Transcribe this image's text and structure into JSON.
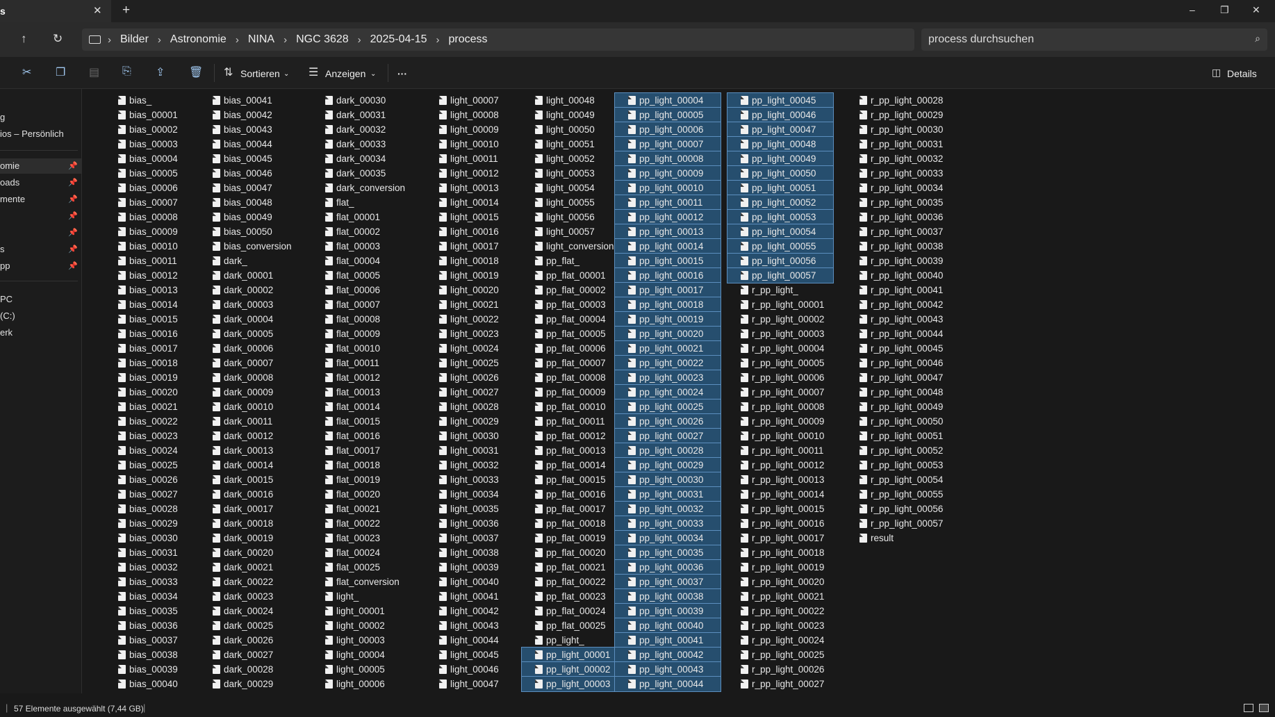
{
  "tab": {
    "title": "s",
    "close": "✕",
    "new": "+"
  },
  "window": {
    "minimize": "–",
    "maximize": "❐",
    "close": "✕"
  },
  "nav": {
    "up": "↑",
    "refresh": "↻"
  },
  "breadcrumb": [
    "Bilder",
    "Astronomie",
    "NINA",
    "NGC 3628",
    "2025-04-15",
    "process"
  ],
  "search": {
    "placeholder": "process durchsuchen"
  },
  "toolbar": {
    "sort": "Sortieren",
    "view": "Anzeigen",
    "more": "···",
    "details": "Details"
  },
  "sidebar": {
    "items": [
      {
        "label": "g"
      },
      {
        "label": "ios – Persönlich"
      },
      {
        "label": "omie"
      },
      {
        "label": "oads"
      },
      {
        "label": "mente"
      },
      {
        "label": ""
      },
      {
        "label": ""
      },
      {
        "label": "s"
      },
      {
        "label": "pp"
      },
      {
        "label": " PC"
      },
      {
        "label": "(C:)"
      },
      {
        "label": "erk"
      }
    ]
  },
  "columns": [
    [
      "bias_",
      "bias_00001",
      "bias_00002",
      "bias_00003",
      "bias_00004",
      "bias_00005",
      "bias_00006",
      "bias_00007",
      "bias_00008",
      "bias_00009",
      "bias_00010",
      "bias_00011",
      "bias_00012",
      "bias_00013",
      "bias_00014",
      "bias_00015",
      "bias_00016",
      "bias_00017",
      "bias_00018",
      "bias_00019",
      "bias_00020",
      "bias_00021",
      "bias_00022",
      "bias_00023",
      "bias_00024",
      "bias_00025",
      "bias_00026",
      "bias_00027",
      "bias_00028",
      "bias_00029",
      "bias_00030",
      "bias_00031",
      "bias_00032",
      "bias_00033",
      "bias_00034",
      "bias_00035",
      "bias_00036",
      "bias_00037",
      "bias_00038",
      "bias_00039",
      "bias_00040"
    ],
    [
      "bias_00041",
      "bias_00042",
      "bias_00043",
      "bias_00044",
      "bias_00045",
      "bias_00046",
      "bias_00047",
      "bias_00048",
      "bias_00049",
      "bias_00050",
      "bias_conversion",
      "dark_",
      "dark_00001",
      "dark_00002",
      "dark_00003",
      "dark_00004",
      "dark_00005",
      "dark_00006",
      "dark_00007",
      "dark_00008",
      "dark_00009",
      "dark_00010",
      "dark_00011",
      "dark_00012",
      "dark_00013",
      "dark_00014",
      "dark_00015",
      "dark_00016",
      "dark_00017",
      "dark_00018",
      "dark_00019",
      "dark_00020",
      "dark_00021",
      "dark_00022",
      "dark_00023",
      "dark_00024",
      "dark_00025",
      "dark_00026",
      "dark_00027",
      "dark_00028",
      "dark_00029"
    ],
    [
      "dark_00030",
      "dark_00031",
      "dark_00032",
      "dark_00033",
      "dark_00034",
      "dark_00035",
      "dark_conversion",
      "flat_",
      "flat_00001",
      "flat_00002",
      "flat_00003",
      "flat_00004",
      "flat_00005",
      "flat_00006",
      "flat_00007",
      "flat_00008",
      "flat_00009",
      "flat_00010",
      "flat_00011",
      "flat_00012",
      "flat_00013",
      "flat_00014",
      "flat_00015",
      "flat_00016",
      "flat_00017",
      "flat_00018",
      "flat_00019",
      "flat_00020",
      "flat_00021",
      "flat_00022",
      "flat_00023",
      "flat_00024",
      "flat_00025",
      "flat_conversion",
      "light_",
      "light_00001",
      "light_00002",
      "light_00003",
      "light_00004",
      "light_00005",
      "light_00006"
    ],
    [
      "light_00007",
      "light_00008",
      "light_00009",
      "light_00010",
      "light_00011",
      "light_00012",
      "light_00013",
      "light_00014",
      "light_00015",
      "light_00016",
      "light_00017",
      "light_00018",
      "light_00019",
      "light_00020",
      "light_00021",
      "light_00022",
      "light_00023",
      "light_00024",
      "light_00025",
      "light_00026",
      "light_00027",
      "light_00028",
      "light_00029",
      "light_00030",
      "light_00031",
      "light_00032",
      "light_00033",
      "light_00034",
      "light_00035",
      "light_00036",
      "light_00037",
      "light_00038",
      "light_00039",
      "light_00040",
      "light_00041",
      "light_00042",
      "light_00043",
      "light_00044",
      "light_00045",
      "light_00046",
      "light_00047"
    ],
    [
      "light_00048",
      "light_00049",
      "light_00050",
      "light_00051",
      "light_00052",
      "light_00053",
      "light_00054",
      "light_00055",
      "light_00056",
      "light_00057",
      "light_conversion",
      "pp_flat_",
      "pp_flat_00001",
      "pp_flat_00002",
      "pp_flat_00003",
      "pp_flat_00004",
      "pp_flat_00005",
      "pp_flat_00006",
      "pp_flat_00007",
      "pp_flat_00008",
      "pp_flat_00009",
      "pp_flat_00010",
      "pp_flat_00011",
      "pp_flat_00012",
      "pp_flat_00013",
      "pp_flat_00014",
      "pp_flat_00015",
      "pp_flat_00016",
      "pp_flat_00017",
      "pp_flat_00018",
      "pp_flat_00019",
      "pp_flat_00020",
      "pp_flat_00021",
      "pp_flat_00022",
      "pp_flat_00023",
      "pp_flat_00024",
      "pp_flat_00025",
      "pp_light_",
      "pp_light_00001",
      "pp_light_00002",
      "pp_light_00003"
    ],
    [
      "pp_light_00004",
      "pp_light_00005",
      "pp_light_00006",
      "pp_light_00007",
      "pp_light_00008",
      "pp_light_00009",
      "pp_light_00010",
      "pp_light_00011",
      "pp_light_00012",
      "pp_light_00013",
      "pp_light_00014",
      "pp_light_00015",
      "pp_light_00016",
      "pp_light_00017",
      "pp_light_00018",
      "pp_light_00019",
      "pp_light_00020",
      "pp_light_00021",
      "pp_light_00022",
      "pp_light_00023",
      "pp_light_00024",
      "pp_light_00025",
      "pp_light_00026",
      "pp_light_00027",
      "pp_light_00028",
      "pp_light_00029",
      "pp_light_00030",
      "pp_light_00031",
      "pp_light_00032",
      "pp_light_00033",
      "pp_light_00034",
      "pp_light_00035",
      "pp_light_00036",
      "pp_light_00037",
      "pp_light_00038",
      "pp_light_00039",
      "pp_light_00040",
      "pp_light_00041",
      "pp_light_00042",
      "pp_light_00043",
      "pp_light_00044"
    ],
    [
      "pp_light_00045",
      "pp_light_00046",
      "pp_light_00047",
      "pp_light_00048",
      "pp_light_00049",
      "pp_light_00050",
      "pp_light_00051",
      "pp_light_00052",
      "pp_light_00053",
      "pp_light_00054",
      "pp_light_00055",
      "pp_light_00056",
      "pp_light_00057",
      "r_pp_light_",
      "r_pp_light_00001",
      "r_pp_light_00002",
      "r_pp_light_00003",
      "r_pp_light_00004",
      "r_pp_light_00005",
      "r_pp_light_00006",
      "r_pp_light_00007",
      "r_pp_light_00008",
      "r_pp_light_00009",
      "r_pp_light_00010",
      "r_pp_light_00011",
      "r_pp_light_00012",
      "r_pp_light_00013",
      "r_pp_light_00014",
      "r_pp_light_00015",
      "r_pp_light_00016",
      "r_pp_light_00017",
      "r_pp_light_00018",
      "r_pp_light_00019",
      "r_pp_light_00020",
      "r_pp_light_00021",
      "r_pp_light_00022",
      "r_pp_light_00023",
      "r_pp_light_00024",
      "r_pp_light_00025",
      "r_pp_light_00026",
      "r_pp_light_00027"
    ],
    [
      "r_pp_light_00028",
      "r_pp_light_00029",
      "r_pp_light_00030",
      "r_pp_light_00031",
      "r_pp_light_00032",
      "r_pp_light_00033",
      "r_pp_light_00034",
      "r_pp_light_00035",
      "r_pp_light_00036",
      "r_pp_light_00037",
      "r_pp_light_00038",
      "r_pp_light_00039",
      "r_pp_light_00040",
      "r_pp_light_00041",
      "r_pp_light_00042",
      "r_pp_light_00043",
      "r_pp_light_00044",
      "r_pp_light_00045",
      "r_pp_light_00046",
      "r_pp_light_00047",
      "r_pp_light_00048",
      "r_pp_light_00049",
      "r_pp_light_00050",
      "r_pp_light_00051",
      "r_pp_light_00052",
      "r_pp_light_00053",
      "r_pp_light_00054",
      "r_pp_light_00055",
      "r_pp_light_00056",
      "r_pp_light_00057",
      "result"
    ]
  ],
  "status": {
    "text": "57 Elemente ausgewählt (7,44 GB)"
  }
}
